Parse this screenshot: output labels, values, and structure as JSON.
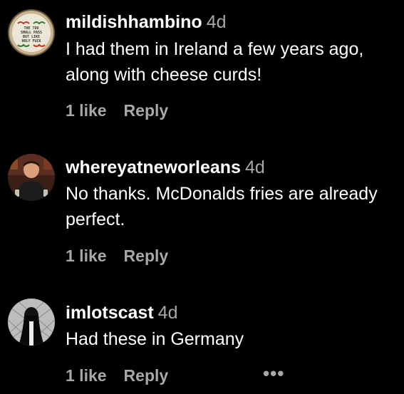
{
  "colors": {
    "background": "#000000",
    "text_primary": "#ffffff",
    "text_secondary": "#a8a8a8"
  },
  "comments": [
    {
      "username": "mildishhambino",
      "timestamp": "4d",
      "text": "I had them in Ireland a few years ago, along with cheese curds!",
      "likes": "1 like",
      "reply": "Reply",
      "avatar_icon": "embroidered-hoop-avatar",
      "avatar_text": [
        "THE TOO",
        "SMALL PASS",
        "BUT LIKE",
        "HOLY FUCK"
      ]
    },
    {
      "username": "whereyatneworleans",
      "timestamp": "4d",
      "text": "No thanks. McDonalds fries are already perfect.",
      "likes": "1 like",
      "reply": "Reply",
      "avatar_icon": "person-photo-avatar"
    },
    {
      "username": "imlotscast",
      "timestamp": "4d",
      "text": "Had these in Germany",
      "likes": "1 like",
      "reply": "Reply",
      "more": "•••",
      "avatar_icon": "dark-figure-avatar"
    }
  ]
}
